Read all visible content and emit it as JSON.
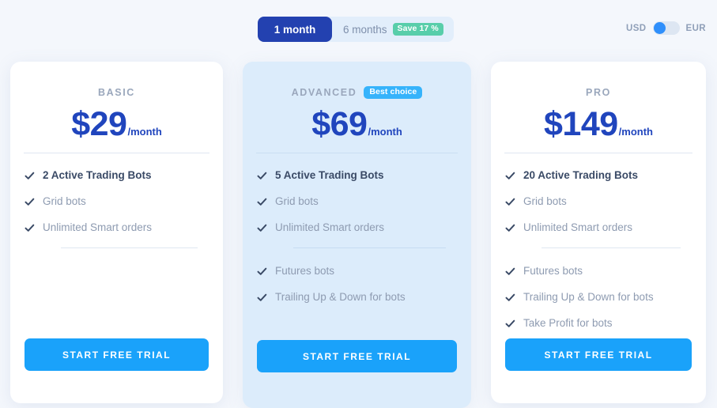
{
  "billing_switch": {
    "options": [
      {
        "label": "1 month",
        "active": true,
        "badge": null
      },
      {
        "label": "6 months",
        "active": false,
        "badge": "Save 17 %"
      }
    ]
  },
  "currency_switch": {
    "left_label": "USD",
    "right_label": "EUR",
    "selected": "USD"
  },
  "colors": {
    "page_background": "#f4f7fc",
    "price_blue": "#2045bd",
    "cta_blue": "#1aa2fa",
    "active_tab_blue": "#2341b0",
    "save_badge_green": "#58ceaa",
    "best_badge_blue": "#36b3fb",
    "highlight_card_background": "#dcecfb",
    "feature_text": "#8e9bb1",
    "primary_feature_text": "#3a4a66"
  },
  "plans": [
    {
      "name": "BASIC",
      "badge": null,
      "currency_symbol": "$",
      "amount": "29",
      "price": "$29",
      "period": "/month",
      "highlighted": false,
      "features_primary": [
        "2 Active Trading Bots"
      ],
      "features_group1": [
        "Grid bots",
        "Unlimited Smart orders"
      ],
      "features_group2": [],
      "cta_label": "START FREE TRIAL"
    },
    {
      "name": "ADVANCED",
      "badge": "Best choice",
      "currency_symbol": "$",
      "amount": "69",
      "price": "$69",
      "period": "/month",
      "highlighted": true,
      "features_primary": [
        "5 Active Trading Bots"
      ],
      "features_group1": [
        "Grid bots",
        "Unlimited Smart orders"
      ],
      "features_group2": [
        "Futures bots",
        "Trailing Up & Down for bots"
      ],
      "cta_label": "START FREE TRIAL"
    },
    {
      "name": "PRO",
      "badge": null,
      "currency_symbol": "$",
      "amount": "149",
      "price": "$149",
      "period": "/month",
      "highlighted": false,
      "features_primary": [
        "20 Active Trading Bots"
      ],
      "features_group1": [
        "Grid bots",
        "Unlimited Smart orders"
      ],
      "features_group2": [
        "Futures bots",
        "Trailing Up & Down for bots",
        "Take Profit for bots"
      ],
      "cta_label": "START FREE TRIAL"
    }
  ],
  "icons": {
    "check": "check-icon"
  }
}
